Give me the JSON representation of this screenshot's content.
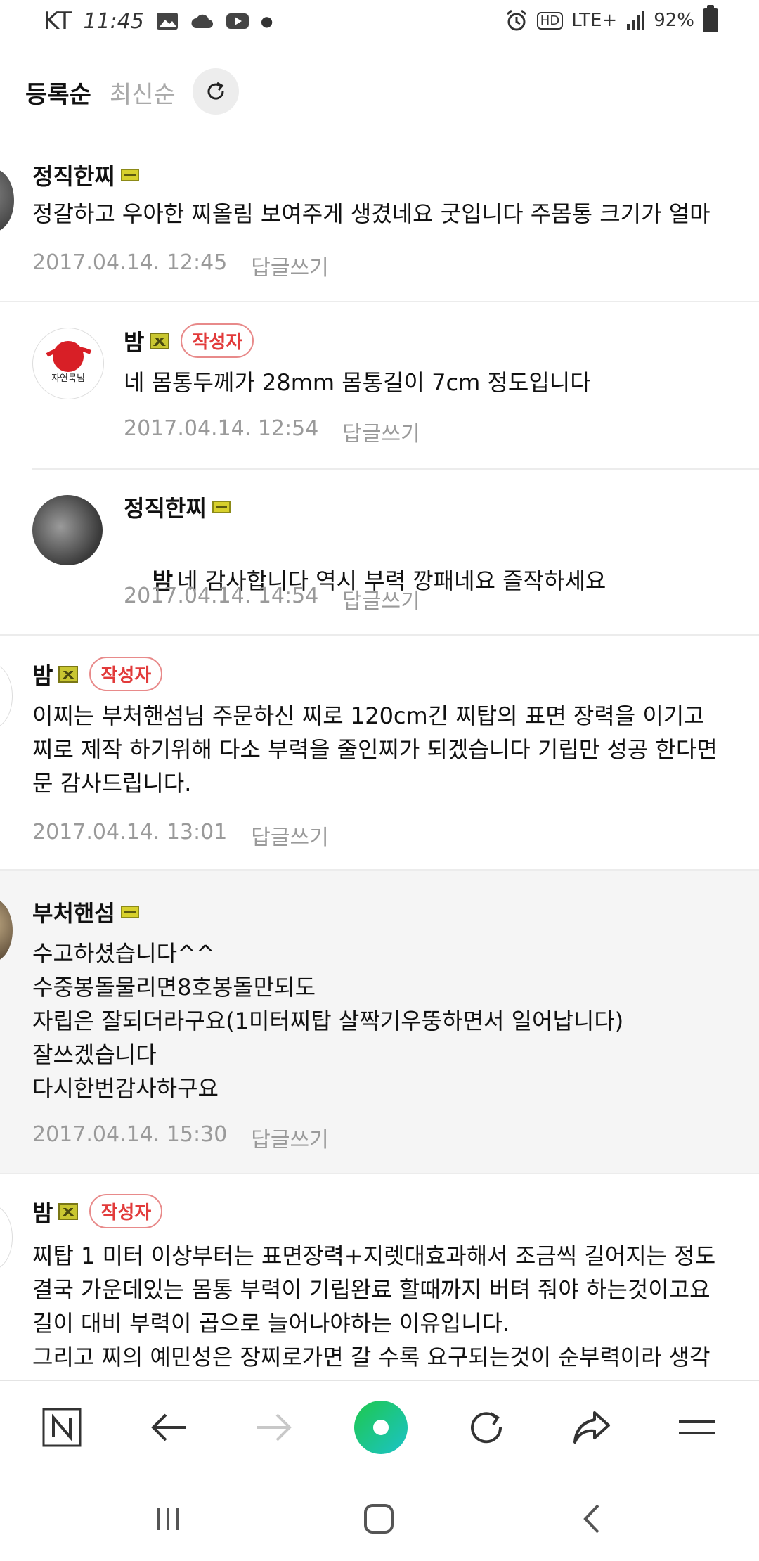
{
  "status_bar": {
    "carrier": "KT",
    "time": "11:45",
    "network": "LTE+",
    "hd": "HD",
    "battery": "92%"
  },
  "sort": {
    "active": "등록순",
    "inactive": "최신순"
  },
  "comments": [
    {
      "author": "정직한찌",
      "text": "정갈하고 우아한 찌올림 보여주게 생겼네요 굿입니다 주몸통 크기가 얼마",
      "date": "2017.04.14. 12:45",
      "reply": "답글쓰기"
    },
    {
      "author": "밤",
      "tag": "작성자",
      "avatar_text": "자연묵님",
      "text": "네 몸통두께가 28mm 몸통길이 7cm 정도입니다",
      "date": "2017.04.14. 12:54",
      "reply": "답글쓰기"
    },
    {
      "author": "정직한찌",
      "mention": "밤",
      "text": "네 감사합니다 역시 부력 깡패네요 즐작하세요",
      "date": "2017.04.14. 14:54",
      "reply": "답글쓰기"
    },
    {
      "author": "밤",
      "tag": "작성자",
      "lines": [
        "이찌는 부처핸섬님 주문하신 찌로 120cm긴 찌탑의 표면 장력을 이기고",
        "찌로 제작 하기위해 다소 부력을 줄인찌가 되겠습니다 기립만 성공 한다면",
        "문 감사드립니다."
      ],
      "date": "2017.04.14. 13:01",
      "reply": "답글쓰기"
    },
    {
      "author": "부처핸섬",
      "lines": [
        "수고하셨습니다^^",
        "수중봉돌물리면8호봉돌만되도",
        "자립은 잘되더라구요(1미터찌탑 살짝기우뚱하면서 일어납니다)",
        "잘쓰겠습니다",
        "다시한번감사하구요"
      ],
      "date": "2017.04.14. 15:30",
      "reply": "답글쓰기"
    },
    {
      "author": "밤",
      "tag": "작성자",
      "lines": [
        "찌탑 1 미터 이상부터는 표면장력+지렛대효과해서 조금씩 길어지는 정도",
        "결국 가운데있는 몸통 부력이 기립완료 할때까지 버텨 줘야 하는것이고요",
        "길이 대비 부력이 곱으로 늘어나야하는 이유입니다.",
        "그리고 찌의 예민성은 장찌로가면 갈 수록 요구되는것이 순부력이라 생각"
      ]
    }
  ],
  "toolbar": {
    "items": [
      "naver-n",
      "back",
      "forward",
      "green-home",
      "refresh",
      "share",
      "menu"
    ]
  },
  "colors": {
    "author_tag": "#e23b3b",
    "green": "#1ec99a"
  }
}
